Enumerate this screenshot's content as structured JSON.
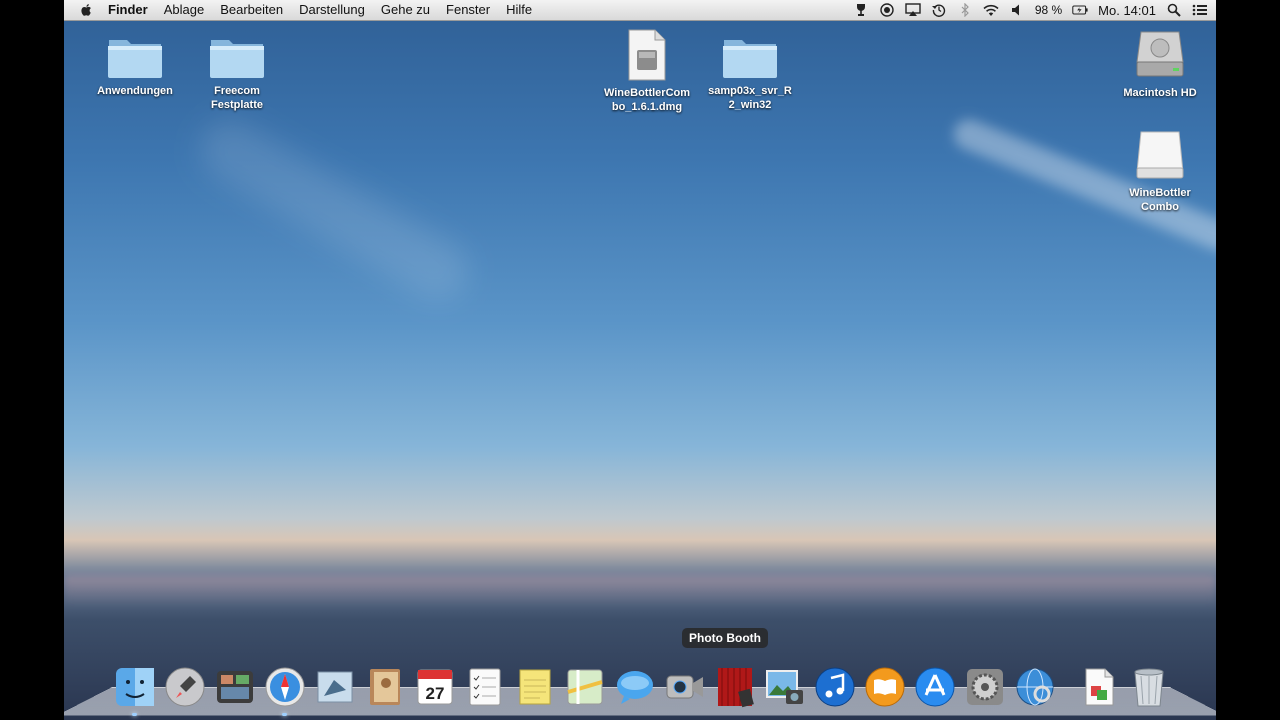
{
  "menubar": {
    "app_name": "Finder",
    "menus": [
      "Ablage",
      "Bearbeiten",
      "Darstellung",
      "Gehe zu",
      "Fenster",
      "Hilfe"
    ],
    "battery": "98 %",
    "clock": "Mo. 14:01",
    "status_icons": [
      "wine-glass-icon",
      "record-icon",
      "airplay-icon",
      "time-machine-icon",
      "bluetooth-icon",
      "wifi-icon",
      "volume-icon",
      "battery-icon",
      "spotlight-icon",
      "notification-center-icon"
    ]
  },
  "desktop": {
    "icons": [
      {
        "label": "Anwendungen",
        "type": "folder"
      },
      {
        "label": "Freecom Festplatte",
        "type": "folder"
      },
      {
        "label": "WineBottlerCombo_1.6.1.dmg",
        "label_lines": [
          "WineBottlerCom",
          "bo_1.6.1.dmg"
        ],
        "type": "dmg-file"
      },
      {
        "label": "samp03x_svr_R2_win32",
        "label_lines": [
          "samp03x_svr_R",
          "2_win32"
        ],
        "type": "folder"
      },
      {
        "label": "Macintosh HD",
        "type": "hard-drive"
      },
      {
        "label": "WineBottler Combo",
        "label_lines": [
          "WineBottler",
          "Combo"
        ],
        "type": "mounted-volume"
      }
    ]
  },
  "dock": {
    "tooltip": "Photo Booth",
    "apps": [
      "Finder",
      "Launchpad",
      "Mission Control",
      "Safari",
      "Mail",
      "Kontakte",
      "Kalender",
      "Erinnerungen",
      "Notizen",
      "Karten",
      "Nachrichten",
      "FaceTime",
      "Photo Booth",
      "iPhoto",
      "iTunes",
      "iBooks",
      "App Store",
      "Systemeinstellungen",
      "Netzwerkdienstprogramm",
      "Dokument",
      "Papierkorb"
    ],
    "calendar_day": "27"
  },
  "colors": {
    "menubar": "#e6e6e6",
    "folder": "#a9cfe9",
    "sky_top": "#2f5f95"
  }
}
